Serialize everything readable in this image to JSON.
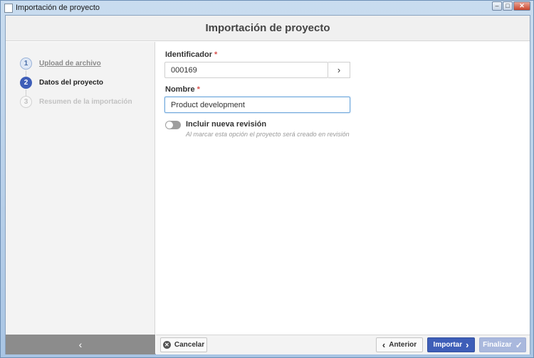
{
  "window": {
    "title": "Importación de proyecto",
    "minimize_glyph": "–",
    "maximize_glyph": "□",
    "close_glyph": "✕"
  },
  "header": {
    "title": "Importación de proyecto"
  },
  "steps": [
    {
      "number": "1",
      "label": "Upload de archivo",
      "state": "completed"
    },
    {
      "number": "2",
      "label": "Datos del proyecto",
      "state": "active"
    },
    {
      "number": "3",
      "label": "Resumen de la importación",
      "state": "pending"
    }
  ],
  "sidebar": {
    "collapse_glyph": "‹"
  },
  "form": {
    "identifier": {
      "label": "Identificador",
      "required_mark": "*",
      "value": "000169",
      "picker_glyph": "›"
    },
    "name": {
      "label": "Nombre",
      "required_mark": "*",
      "value": "Product development"
    },
    "revision_toggle": {
      "label": "Incluir nueva revisión",
      "on": false,
      "help": "Al marcar esta opción el proyecto será creado en revisión"
    }
  },
  "footer": {
    "cancel": {
      "label": "Cancelar",
      "icon": "close-circle-icon",
      "glyph": "✕"
    },
    "previous": {
      "label": "Anterior",
      "icon": "chevron-left-icon",
      "glyph": "‹"
    },
    "import": {
      "label": "Importar",
      "icon": "chevron-right-icon",
      "glyph": "›"
    },
    "finish": {
      "label": "Finalizar",
      "icon": "check-icon",
      "glyph": "✓",
      "enabled": false
    }
  },
  "colors": {
    "primary": "#3e5eb8",
    "primary_disabled": "#a9b8dd",
    "required": "#d9534f",
    "focus_border": "#6fa8dc"
  }
}
